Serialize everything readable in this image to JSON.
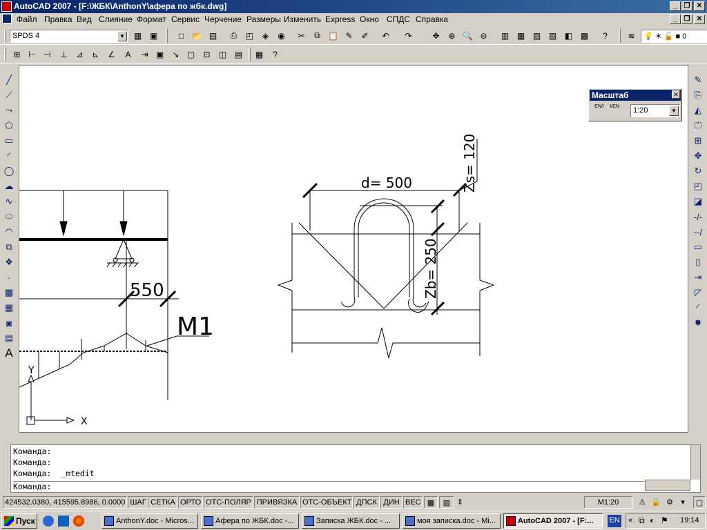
{
  "window": {
    "title": "AutoCAD 2007 - [F:\\ЖБК\\AnthonY\\афера по жбк.dwg]",
    "controls": [
      "_",
      "❐",
      "✕"
    ]
  },
  "menu": [
    "Файл",
    "Правка",
    "Вид",
    "Слияние",
    "Формат",
    "Сервис",
    "Черчение",
    "Размеры",
    "Изменить",
    "Express",
    "Окно",
    "СПДС",
    "Справка"
  ],
  "toolbar": {
    "style_combo": "SPDS 4",
    "layer_value": "0"
  },
  "scale_panel": {
    "title": "Масштаб",
    "btn1": "EN/I",
    "btn2": "I/EN",
    "value": "1:20"
  },
  "drawing": {
    "dim_550": "550",
    "label_m1": "M1",
    "axis_y": "Y",
    "axis_x": "X",
    "dim_d": "d= 500",
    "dim_zs": "Zs= 120",
    "dim_zb": "Zb= 250"
  },
  "command": {
    "lines": [
      "Команда:",
      "Команда:",
      "Команда:  _mtedit"
    ],
    "prompt": "Команда:"
  },
  "status": {
    "coords": "424532.0380, 415595.8986, 0.0000",
    "toggles": [
      "ШАГ",
      "СЕТКА",
      "ОРТО",
      "ОТС-ПОЛЯР",
      "ПРИВЯЗКА",
      "ОТС-ОБЪЕКТ",
      "ДПСК",
      "ДИН",
      "ВЕС"
    ],
    "scale": "M1:20"
  },
  "taskbar": {
    "start": "Пуск",
    "tasks": [
      "AnthonY.doc - Micros...",
      "Афера по ЖБК.doc -...",
      "Записка ЖБК.doc - ...",
      "моя записка.doc - Mi...",
      "AutoCAD 2007 - [F:..."
    ],
    "lang": "EN",
    "clock": "19:14"
  }
}
